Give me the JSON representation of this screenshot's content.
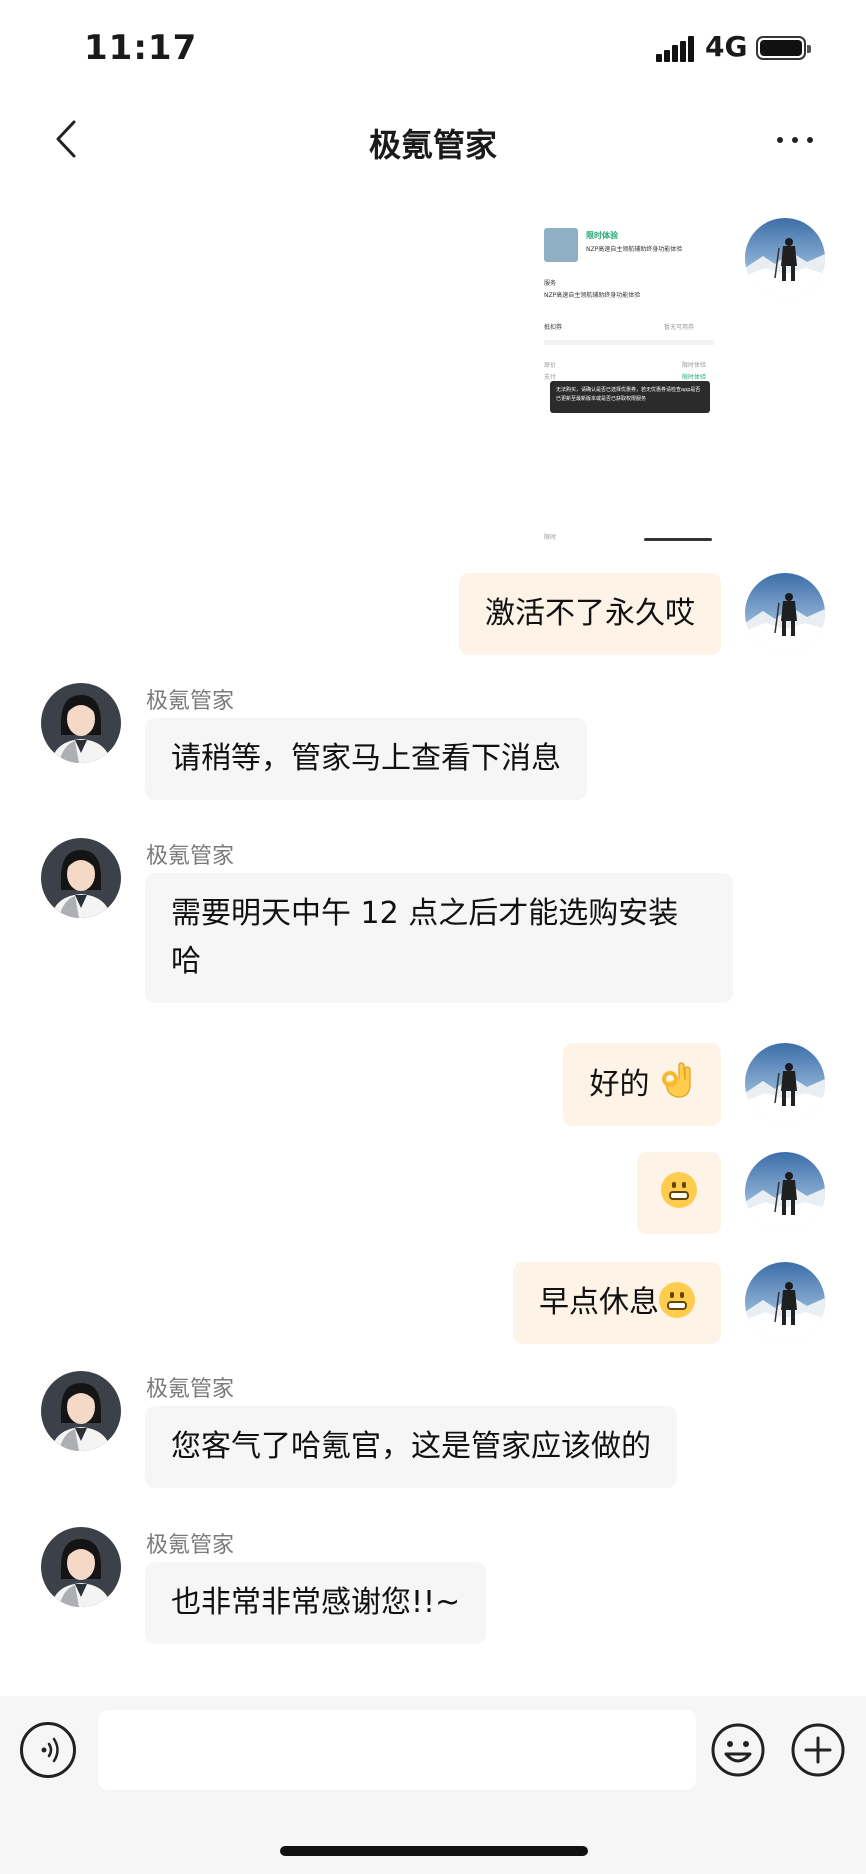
{
  "status_bar": {
    "time": "11:17",
    "network": "4G"
  },
  "nav": {
    "title": "极氪管家"
  },
  "image_message": {
    "title": "限时体验",
    "subtitle": "NZP高速自主领航辅助终身功能体验",
    "section": "服务",
    "section_desc": "NZP高速自主领航辅助终身功能体验",
    "coupon_label": "抵扣券",
    "coupon_value": "暂无可用券",
    "original_label": "原价",
    "original_value": "限时体验",
    "pay_label": "支付",
    "pay_value": "限时体验",
    "toast": "无法购买，请确认是否已选择优惠券，若无优惠券请检查app是否已更新至最新版本或是否已获取权限服务",
    "bottom_label": "限时"
  },
  "messages": [
    {
      "side": "out",
      "text": "激活不了永久哎"
    },
    {
      "side": "in",
      "sender": "极氪管家",
      "text": "请稍等，管家马上查看下消息"
    },
    {
      "side": "in",
      "sender": "极氪管家",
      "text_line1": "需要明天中午 12 点之后才能选购安装",
      "text_line2": "哈"
    },
    {
      "side": "out",
      "text": "好的",
      "emoji": "ok-hand-emoji"
    },
    {
      "side": "out",
      "emoji": "grimacing-emoji"
    },
    {
      "side": "out",
      "text": "早点休息",
      "emoji": "grimacing-emoji"
    },
    {
      "side": "in",
      "sender": "极氪管家",
      "text": "您客气了哈氪官，这是管家应该做的"
    },
    {
      "side": "in",
      "sender": "极氪管家",
      "text": "也非常非常感谢您!!~"
    }
  ],
  "input": {
    "placeholder": ""
  },
  "icons": {
    "back": "chevron-left-icon",
    "more": "more-dots-icon",
    "voice": "voice-icon",
    "emoji": "smiley-icon",
    "plus": "plus-icon"
  },
  "colors": {
    "outgoing_bubble": "#fdf3e6",
    "incoming_bubble": "#f6f6f6",
    "accent_green": "#2aa876"
  }
}
